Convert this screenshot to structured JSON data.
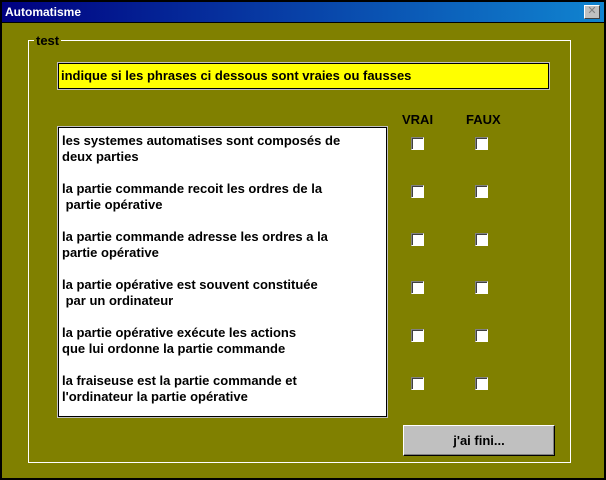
{
  "window": {
    "title": "Automatisme",
    "close_icon": "close-icon"
  },
  "group": {
    "label": "test"
  },
  "instruction": "indique si les phrases ci dessous sont vraies ou fausses",
  "columns": {
    "true": "VRAI",
    "false": "FAUX"
  },
  "questions": [
    {
      "text": "les systemes automatises sont composés de\ndeux parties",
      "vrai": false,
      "faux": false
    },
    {
      "text": "la partie commande recoit les ordres de la\n partie opérative",
      "vrai": false,
      "faux": false
    },
    {
      "text": "la partie commande adresse les ordres a la\npartie opérative",
      "vrai": false,
      "faux": false
    },
    {
      "text": "la partie opérative est souvent constituée\n par un ordinateur",
      "vrai": false,
      "faux": false
    },
    {
      "text": "la partie opérative exécute les actions\nque lui ordonne la partie commande",
      "vrai": false,
      "faux": false
    },
    {
      "text": "la fraiseuse est la partie commande et\nl'ordinateur la partie opérative",
      "vrai": false,
      "faux": false
    }
  ],
  "button": {
    "label": "j'ai fini..."
  },
  "colors": {
    "background": "#808000",
    "instruction_bg": "#ffff00",
    "titlebar": "#000080"
  }
}
